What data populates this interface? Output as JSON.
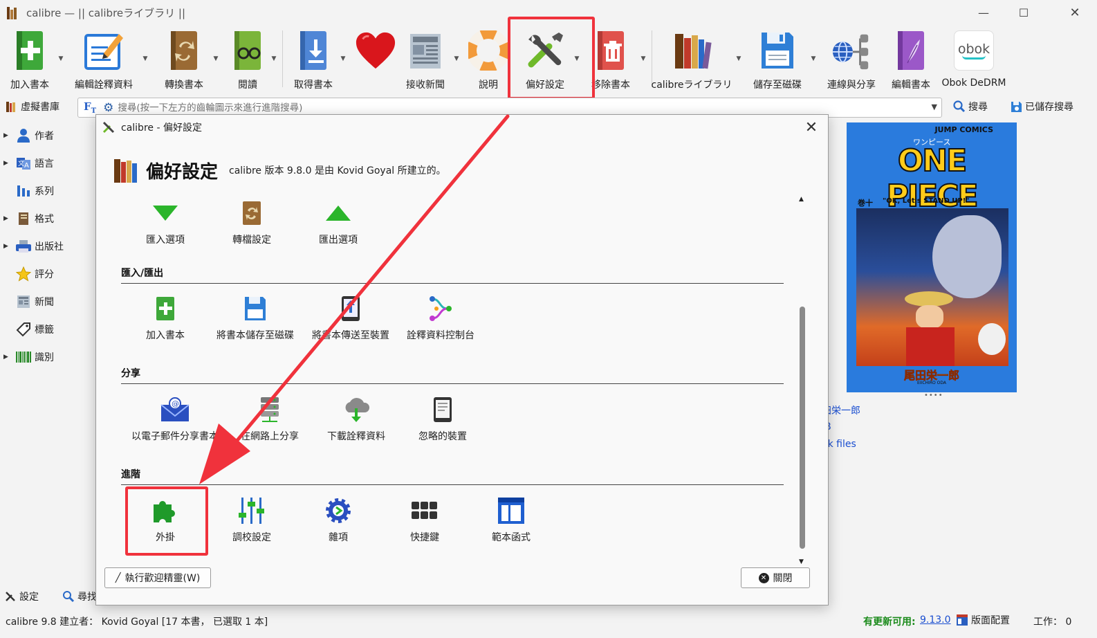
{
  "window": {
    "title": "calibre — || calibreライブラリ ||",
    "minimize": "—",
    "maximize": "☐",
    "close": "✕"
  },
  "toolbar": {
    "add_book": "加入書本",
    "edit_metadata": "編輯詮釋資料",
    "convert": "轉換書本",
    "read": "閱讀",
    "get_books": "取得書本",
    "fetch_news": "接收新聞",
    "help": "說明",
    "preferences": "偏好設定",
    "remove": "移除書本",
    "library": "calibreライブラリ",
    "save_to_disk": "儲存至磁碟",
    "connect_share": "連線與分享",
    "edit_book": "編輯書本",
    "obok": "Obok DeDRM",
    "obok_logo": "obok"
  },
  "searchrow": {
    "virtual_library": "虛擬書庫",
    "search_placeholder": "搜尋(按一下左方的齒輪圖示來進行進階搜尋)",
    "search_button": "搜尋",
    "saved_search": "已儲存搜尋"
  },
  "sidebar": {
    "items": [
      {
        "label": "作者",
        "expandable": true
      },
      {
        "label": "語言",
        "expandable": true
      },
      {
        "label": "系列",
        "expandable": false
      },
      {
        "label": "格式",
        "expandable": true
      },
      {
        "label": "出版社",
        "expandable": true
      },
      {
        "label": "評分",
        "expandable": false
      },
      {
        "label": "新聞",
        "expandable": false
      },
      {
        "label": "標籤",
        "expandable": false
      },
      {
        "label": "識別",
        "expandable": true
      }
    ]
  },
  "bottomstrip": {
    "settings": "設定",
    "find": "尋找"
  },
  "cover": {
    "publisher_label": "JUMP COMICS",
    "title": "ONE PIECE",
    "subtitle_katakana": "ワンピース",
    "volume": "巻十",
    "volume_title": "\"OK, Let's STAND UP!\"",
    "author": "尾田栄一郎",
    "author_romaji": "EIICHIRO ODA"
  },
  "details": {
    "author_fragment": "田栄一郎",
    "format_fragment": "JB",
    "files_fragment": "ok files"
  },
  "dialog": {
    "title": "calibre - 偏好設定",
    "heading": "偏好設定",
    "version_text": "calibre 版本 9.8.0 是由 Kovid Goyal 所建立的。",
    "top_items": [
      "匯入選項",
      "轉檔設定",
      "匯出選項"
    ],
    "sections": [
      {
        "title": "匯入/匯出",
        "items": [
          "加入書本",
          "將書本儲存至磁碟",
          "將書本傳送至裝置",
          "詮釋資料控制台"
        ]
      },
      {
        "title": "分享",
        "items": [
          "以電子郵件分享書本",
          "在網路上分享",
          "下載詮釋資料",
          "忽略的裝置"
        ]
      },
      {
        "title": "進階",
        "items": [
          "外掛",
          "調校設定",
          "雜項",
          "快捷鍵",
          "範本函式"
        ]
      }
    ],
    "wizard_button": "執行歡迎精靈(W)",
    "close_button": "關閉"
  },
  "status": {
    "left": "calibre 9.8 建立者： Kovid Goyal [17 本書， 已選取 1 本]",
    "update_label": "有更新可用:",
    "update_version": "9.13.0",
    "layout": "版面配置",
    "jobs": "工作： 0"
  },
  "colors": {
    "highlight": "#f0323c",
    "link": "#1a4ed0",
    "update_green": "#1a8a1a",
    "cover_blue": "#2a7bdd"
  }
}
